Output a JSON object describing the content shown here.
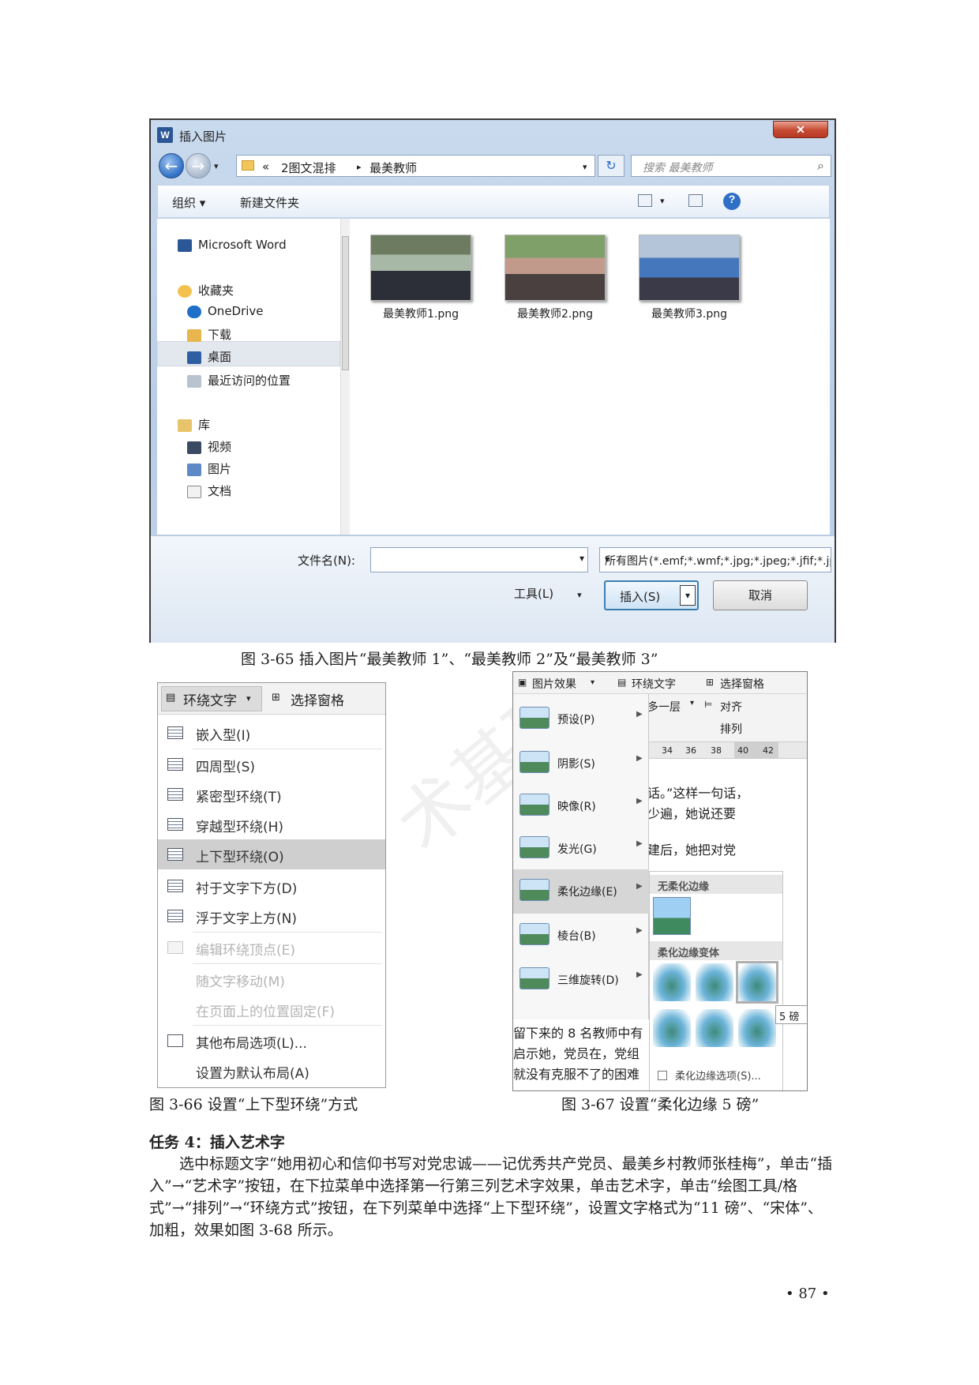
{
  "dialog": {
    "title": "插入图片",
    "close": "✕",
    "breadcrumb": [
      "«",
      "2图文混排",
      "▸",
      "最美教师"
    ],
    "search_placeholder": "搜索 最美教师",
    "toolbar": {
      "organize": "组织 ▾",
      "new_folder": "新建文件夹"
    },
    "nav": {
      "word": "Microsoft Word",
      "favorites": "收藏夹",
      "onedrive": "OneDrive",
      "downloads": "下载",
      "desktop": "桌面",
      "recent": "最近访问的位置",
      "libraries": "库",
      "videos": "视频",
      "pictures": "图片",
      "documents": "文档"
    },
    "files": [
      "最美教师1.png",
      "最美教师2.png",
      "最美教师3.png"
    ],
    "filename_label": "文件名(N):",
    "filename_value": "",
    "filetype": "所有图片(*.emf;*.wmf;*.jpg;*.jpeg;*.jfif;*.jpe;*.png",
    "tools": "工具(L)",
    "insert": "插入(S)",
    "cancel": "取消"
  },
  "captions": {
    "fig65": "图 3-65  插入图片“最美教师 1”、“最美教师 2”及“最美教师 3”",
    "fig66": "图 3-66  设置“上下型环绕”方式",
    "fig67": "图 3-67  设置“柔化边缘 5 磅”"
  },
  "wrap_menu": {
    "header_wrap": "环绕文字",
    "header_pane": "选择窗格",
    "items": [
      "嵌入型(I)",
      "四周型(S)",
      "紧密型环绕(T)",
      "穿越型环绕(H)",
      "上下型环绕(O)",
      "衬于文字下方(D)",
      "浮于文字上方(N)",
      "编辑环绕顶点(E)",
      "随文字移动(M)",
      "在页面上的位置固定(F)",
      "其他布局选项(L)...",
      "设置为默认布局(A)"
    ]
  },
  "effects_menu": {
    "ribbon": {
      "effects": "图片效果",
      "wrap": "环绕文字",
      "pane": "选择窗格",
      "forward": "多一层",
      "align": "对齐",
      "arrange": "排列"
    },
    "ruler": [
      "34",
      "36",
      "38",
      "40",
      "42"
    ],
    "items": [
      "预设(P)",
      "阴影(S)",
      "映像(R)",
      "发光(G)",
      "柔化边缘(E)",
      "棱台(B)",
      "三维旋转(D)"
    ],
    "sub_none": "无柔化边缘",
    "sub_variants": "柔化边缘变体",
    "tooltip": "5 磅",
    "options": "柔化边缘选项(S)...",
    "doc_lines": [
      "话。”这样一句话，",
      "少遍，她说还要",
      "建后，她把对党",
      "留下来的 8 名教师中有",
      "启示她，党员在，党组",
      "就没有克服不了的困难"
    ]
  },
  "task": {
    "heading": "任务 4：插入艺术字",
    "body": "选中标题文字“她用初心和信仰书写对党忠诚——记优秀共产党员、最美乡村教师张桂梅”，单击“插入”→“艺术字”按钮，在下拉菜单中选择第一行第三列艺术字效果，单击艺术字，单击“绘图工具/格式”→“排列”→“环绕方式”按钮，在下列菜单中选择“上下型环绕”，设置文字格式为“11 磅”、“宋体”、加粗，效果如图 3-68 所示。"
  },
  "page_number": "• 87 •"
}
